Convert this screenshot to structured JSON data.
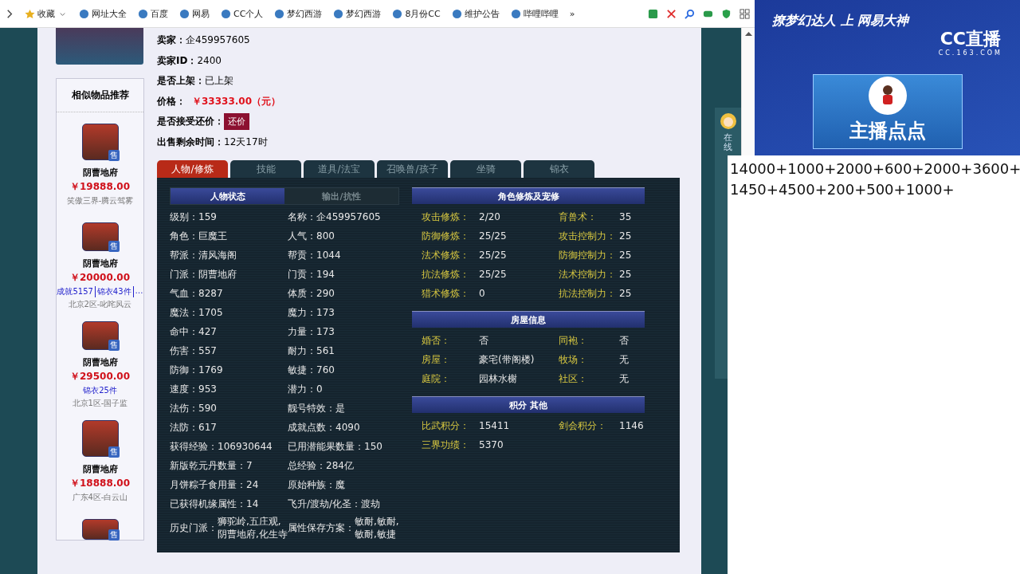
{
  "bookmarks_bar": {
    "items": [
      {
        "label": "收藏",
        "kind": "dropdown"
      },
      {
        "label": "网址大全",
        "kind": "site"
      },
      {
        "label": "百度",
        "kind": "site"
      },
      {
        "label": "网易",
        "kind": "site"
      },
      {
        "label": "CC个人",
        "kind": "site"
      },
      {
        "label": "梦幻西游",
        "kind": "site"
      },
      {
        "label": "梦幻西游",
        "kind": "site"
      },
      {
        "label": "8月份CC",
        "kind": "site"
      },
      {
        "label": "维护公告",
        "kind": "site"
      },
      {
        "label": "哔哩哔哩",
        "kind": "site"
      }
    ],
    "overflow": "»"
  },
  "sidebar": {
    "title": "相似物品推荐",
    "items": [
      {
        "kind": "listing",
        "badge": "售",
        "school": "阴曹地府",
        "price": "￥19888.00",
        "server": "笑傲三界-腾云驾雾"
      },
      {
        "kind": "listing",
        "badge": "售",
        "school": "阴曹地府",
        "price": "￥20000.00",
        "tags": [
          "成就5157",
          "锦衣43件",
          "…"
        ],
        "server": "北京2区-叱咤风云"
      },
      {
        "kind": "listing",
        "badge": "售",
        "school": "阴曹地府",
        "price": "￥29500.00",
        "tags": [
          "锦衣25件"
        ],
        "server": "北京1区-国子监"
      },
      {
        "kind": "listing",
        "badge": "售",
        "school": "阴曹地府",
        "price": "￥18888.00",
        "server": "广东4区-白云山"
      },
      {
        "kind": "cut-off",
        "badge": "售"
      }
    ]
  },
  "listing": {
    "fields": [
      {
        "kind": "text",
        "label": "卖家：",
        "value": "企459957605"
      },
      {
        "kind": "text",
        "label": "卖家ID：",
        "value": "2400"
      },
      {
        "kind": "text",
        "label": "是否上架：",
        "value": "已上架"
      },
      {
        "kind": "price",
        "label": "价格：",
        "value": "￥33333.00（元）"
      },
      {
        "kind": "button",
        "label": "是否接受还价：",
        "value": "还价"
      },
      {
        "kind": "text",
        "label": "出售剩余时间：",
        "value": "12天17时"
      }
    ]
  },
  "tabs": [
    {
      "label": "人物/修炼",
      "selected": true
    },
    {
      "label": "技能",
      "selected": false
    },
    {
      "label": "道具/法宝",
      "selected": false
    },
    {
      "label": "召唤兽/孩子",
      "selected": false
    },
    {
      "label": "坐骑",
      "selected": false
    },
    {
      "label": "锦衣",
      "selected": false
    }
  ],
  "character": {
    "subtabs": [
      {
        "label": "人物状态",
        "selected": true
      },
      {
        "label": "输出/抗性",
        "selected": false
      }
    ],
    "stats": [
      {
        "label": "级别：",
        "value": "159"
      },
      {
        "label": "名称：",
        "value": "企459957605"
      },
      {
        "label": "角色：",
        "value": "巨魔王"
      },
      {
        "label": "人气：",
        "value": "800"
      },
      {
        "label": "帮派：",
        "value": "清风海阁"
      },
      {
        "label": "帮贡：",
        "value": "1044"
      },
      {
        "label": "门派：",
        "value": "阴曹地府"
      },
      {
        "label": "门贡：",
        "value": "194"
      },
      {
        "label": "气血：",
        "value": "8287"
      },
      {
        "label": "体质：",
        "value": "290"
      },
      {
        "label": "魔法：",
        "value": "1705"
      },
      {
        "label": "魔力：",
        "value": "173"
      },
      {
        "label": "命中：",
        "value": "427"
      },
      {
        "label": "力量：",
        "value": "173"
      },
      {
        "label": "伤害：",
        "value": "557"
      },
      {
        "label": "耐力：",
        "value": "561"
      },
      {
        "label": "防御：",
        "value": "1769"
      },
      {
        "label": "敏捷：",
        "value": "760"
      },
      {
        "label": "速度：",
        "value": "953"
      },
      {
        "label": "潜力：",
        "value": "0"
      },
      {
        "label": "法伤：",
        "value": "590"
      },
      {
        "label": "靓号特效：",
        "value": "是"
      },
      {
        "label": "法防：",
        "value": "617"
      },
      {
        "label": "成就点数：",
        "value": "4090"
      },
      {
        "label": "获得经验：",
        "value": "106930644"
      },
      {
        "label": "已用潜能果数量：",
        "value": "150"
      },
      {
        "label": "新版乾元丹数量：",
        "value": "7"
      },
      {
        "label": "总经验：",
        "value": "284亿"
      },
      {
        "label": "月饼粽子食用量：",
        "value": "24"
      },
      {
        "label": "原始种族：",
        "value": "魔"
      },
      {
        "label": "已获得机缘属性：",
        "value": "14"
      },
      {
        "label": "飞升/渡劫/化圣：",
        "value": "渡劫"
      },
      {
        "label": "历史门派：",
        "value": "狮驼岭,五庄观,阴曹地府,化生寺"
      },
      {
        "label": "属性保存方案：",
        "value": "敏耐,敏耐,敏耐,敏捷"
      }
    ],
    "sections": [
      {
        "title": "角色修炼及宠修",
        "items": [
          {
            "label": "攻击修炼：",
            "value": "2/20"
          },
          {
            "label": "育兽术：",
            "value": "35"
          },
          {
            "label": "防御修炼：",
            "value": "25/25"
          },
          {
            "label": "攻击控制力：",
            "value": "25"
          },
          {
            "label": "法术修炼：",
            "value": "25/25"
          },
          {
            "label": "防御控制力：",
            "value": "25"
          },
          {
            "label": "抗法修炼：",
            "value": "25/25"
          },
          {
            "label": "法术控制力：",
            "value": "25"
          },
          {
            "label": "猎术修炼：",
            "value": "0"
          },
          {
            "label": "抗法控制力：",
            "value": "25"
          }
        ]
      },
      {
        "title": "房屋信息",
        "items": [
          {
            "label": "婚否：",
            "value": "否"
          },
          {
            "label": "同袍：",
            "value": "否"
          },
          {
            "label": "房屋：",
            "value": "豪宅(带阁楼)"
          },
          {
            "label": "牧场：",
            "value": "无"
          },
          {
            "label": "庭院：",
            "value": "园林水榭"
          },
          {
            "label": "社区：",
            "value": "无"
          }
        ]
      },
      {
        "title": "积分 其他",
        "items": [
          {
            "label": "比武积分：",
            "value": "15411"
          },
          {
            "label": "剑会积分：",
            "value": "1146"
          },
          {
            "label": "三界功绩：",
            "value": "5370"
          }
        ]
      }
    ]
  },
  "side_widget": {
    "label": "在线"
  },
  "stream_overlay": {
    "banner": "撩梦幻达人 上 网易大神",
    "logo": "CC直播",
    "logo_url": "CC.163.COM",
    "card_title": "主播点点"
  },
  "notepad": {
    "lines": [
      "14000+1000+2000+600+2000+3600+",
      "1450+4500+200+500+1000+"
    ]
  }
}
